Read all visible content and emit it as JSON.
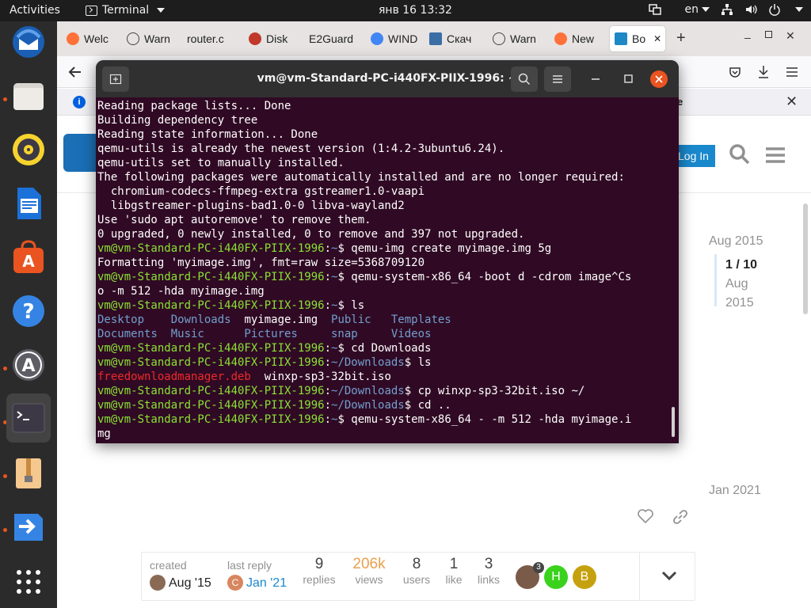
{
  "topbar": {
    "activities": "Activities",
    "app_name": "Terminal",
    "clock": "янв 16  13:32",
    "language": "en"
  },
  "browser": {
    "tabs": [
      {
        "label": "Welc",
        "icon": "firefox-icon",
        "color": "#ff7139"
      },
      {
        "label": "Warn",
        "icon": "info-icon",
        "color": "#444444"
      },
      {
        "label": "router.c",
        "icon": "",
        "color": ""
      },
      {
        "label": "Disk",
        "icon": "disk-icon",
        "color": "#c0392b"
      },
      {
        "label": "E2Guard",
        "icon": "",
        "color": ""
      },
      {
        "label": "WIND",
        "icon": "google-icon",
        "color": "#4285f4"
      },
      {
        "label": "Скач",
        "icon": "site-icon",
        "color": "#3a6ea5"
      },
      {
        "label": "Warn",
        "icon": "info-icon",
        "color": "#444444"
      },
      {
        "label": "New",
        "icon": "firefox-icon",
        "color": "#ff7139"
      },
      {
        "label": "Bo",
        "icon": "site-icon",
        "color": "#1e88c7"
      }
    ],
    "infobar_tail": "ore",
    "login_label": "Log In"
  },
  "forum": {
    "timeline_start": "Aug 2015",
    "timeline_pos": "1 / 10",
    "timeline_date_1": "Aug",
    "timeline_date_2": "2015",
    "timeline_end": "Jan 2021",
    "created_label": "created",
    "created_date": "Aug '15",
    "last_reply_label": "last reply",
    "last_reply_date": "Jan '21",
    "stats": [
      {
        "value": "9",
        "label": "replies"
      },
      {
        "value": "206k",
        "label": "views"
      },
      {
        "value": "8",
        "label": "users"
      },
      {
        "value": "1",
        "label": "like"
      },
      {
        "value": "3",
        "label": "links"
      }
    ],
    "avatar_count": "3",
    "avatar_h": "H",
    "avatar_b": "B",
    "avatar_c": "C"
  },
  "terminal": {
    "title": "vm@vm-Standard-PC-i440FX-PIIX-1996: ~",
    "lines": [
      [
        {
          "t": "Reading package lists... Done",
          "c": ""
        }
      ],
      [
        {
          "t": "Building dependency tree",
          "c": ""
        }
      ],
      [
        {
          "t": "Reading state information... Done",
          "c": ""
        }
      ],
      [
        {
          "t": "qemu-utils is already the newest version (1:4.2-3ubuntu6.24).",
          "c": ""
        }
      ],
      [
        {
          "t": "qemu-utils set to manually installed.",
          "c": ""
        }
      ],
      [
        {
          "t": "The following packages were automatically installed and are no longer required:",
          "c": ""
        }
      ],
      [
        {
          "t": "  chromium-codecs-ffmpeg-extra gstreamer1.0-vaapi",
          "c": ""
        }
      ],
      [
        {
          "t": "  libgstreamer-plugins-bad1.0-0 libva-wayland2",
          "c": ""
        }
      ],
      [
        {
          "t": "Use 'sudo apt autoremove' to remove them.",
          "c": ""
        }
      ],
      [
        {
          "t": "0 upgraded, 0 newly installed, 0 to remove and 397 not upgraded.",
          "c": ""
        }
      ],
      [
        {
          "t": "vm@vm-Standard-PC-i440FX-PIIX-1996",
          "c": "u"
        },
        {
          "t": ":",
          "c": ""
        },
        {
          "t": "~",
          "c": "p"
        },
        {
          "t": "$ qemu-img create myimage.img 5g",
          "c": ""
        }
      ],
      [
        {
          "t": "Formatting 'myimage.img', fmt=raw size=5368709120",
          "c": ""
        }
      ],
      [
        {
          "t": "vm@vm-Standard-PC-i440FX-PIIX-1996",
          "c": "u"
        },
        {
          "t": ":",
          "c": ""
        },
        {
          "t": "~",
          "c": "p"
        },
        {
          "t": "$ qemu-system-x86_64 -boot d -cdrom image^Cs",
          "c": ""
        }
      ],
      [
        {
          "t": "o -m 512 -hda myimage.img",
          "c": ""
        }
      ],
      [
        {
          "t": "vm@vm-Standard-PC-i440FX-PIIX-1996",
          "c": "u"
        },
        {
          "t": ":",
          "c": ""
        },
        {
          "t": "~",
          "c": "p"
        },
        {
          "t": "$ ls",
          "c": ""
        }
      ],
      [
        {
          "t": "Desktop    Downloads  ",
          "c": "p"
        },
        {
          "t": "myimage.img  ",
          "c": ""
        },
        {
          "t": "Public   Templates",
          "c": "p"
        }
      ],
      [
        {
          "t": "Documents  Music      Pictures     snap     Videos",
          "c": "p"
        }
      ],
      [
        {
          "t": "vm@vm-Standard-PC-i440FX-PIIX-1996",
          "c": "u"
        },
        {
          "t": ":",
          "c": ""
        },
        {
          "t": "~",
          "c": "p"
        },
        {
          "t": "$ cd Downloads",
          "c": ""
        }
      ],
      [
        {
          "t": "vm@vm-Standard-PC-i440FX-PIIX-1996",
          "c": "u"
        },
        {
          "t": ":",
          "c": ""
        },
        {
          "t": "~/Downloads",
          "c": "p"
        },
        {
          "t": "$ ls",
          "c": ""
        }
      ],
      [
        {
          "t": "freedownloadmanager.deb",
          "c": "r"
        },
        {
          "t": "  winxp-sp3-32bit.iso",
          "c": ""
        }
      ],
      [
        {
          "t": "vm@vm-Standard-PC-i440FX-PIIX-1996",
          "c": "u"
        },
        {
          "t": ":",
          "c": ""
        },
        {
          "t": "~/Downloads",
          "c": "p"
        },
        {
          "t": "$ cp winxp-sp3-32bit.iso ~/",
          "c": ""
        }
      ],
      [
        {
          "t": "vm@vm-Standard-PC-i440FX-PIIX-1996",
          "c": "u"
        },
        {
          "t": ":",
          "c": ""
        },
        {
          "t": "~/Downloads",
          "c": "p"
        },
        {
          "t": "$ cd ..",
          "c": ""
        }
      ],
      [
        {
          "t": "vm@vm-Standard-PC-i440FX-PIIX-1996",
          "c": "u"
        },
        {
          "t": ":",
          "c": ""
        },
        {
          "t": "~",
          "c": "p"
        },
        {
          "t": "$ qemu-system-x86_64 - -m 512 -hda myimage.i",
          "c": ""
        }
      ],
      [
        {
          "t": "mg",
          "c": ""
        }
      ]
    ]
  }
}
